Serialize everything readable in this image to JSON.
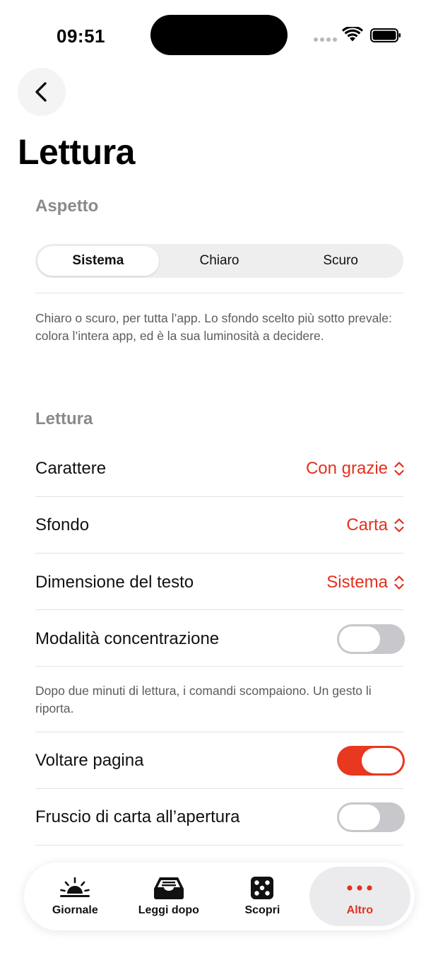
{
  "status_bar": {
    "time": "09:51"
  },
  "page": {
    "title": "Lettura"
  },
  "aspetto": {
    "heading": "Aspetto",
    "segments": [
      "Sistema",
      "Chiaro",
      "Scuro"
    ],
    "selected": "Sistema",
    "footnote": "Chiaro o scuro, per tutta l’app. Lo sfondo scelto più sotto prevale: colora l’intera app, ed è la sua luminosità a decidere."
  },
  "lettura": {
    "heading": "Lettura",
    "rows": [
      {
        "label": "Carattere",
        "value": "Con grazie"
      },
      {
        "label": "Sfondo",
        "value": "Carta"
      },
      {
        "label": "Dimensione del testo",
        "value": "Sistema"
      }
    ],
    "focus_mode": {
      "label": "Modalità concentrazione",
      "on": false
    },
    "focus_footnote": "Dopo due minuti di lettura, i comandi scompaiono. Un gesto li riporta.",
    "page_turn": {
      "label": "Voltare pagina",
      "on": true
    },
    "paper_sound": {
      "label": "Fruscio di carta all’apertura",
      "on": false
    }
  },
  "tab_bar": {
    "items": [
      {
        "label": "Giornale",
        "icon": "sunrise-icon"
      },
      {
        "label": "Leggi dopo",
        "icon": "tray-icon"
      },
      {
        "label": "Scopri",
        "icon": "dice-icon"
      },
      {
        "label": "Altro",
        "icon": "more-icon"
      }
    ],
    "active": "Altro"
  },
  "colors": {
    "accent": "#e0321e",
    "toggle_on": "#e8381f",
    "toggle_off": "#c7c7cc",
    "section_heading": "#8a8a8e"
  }
}
